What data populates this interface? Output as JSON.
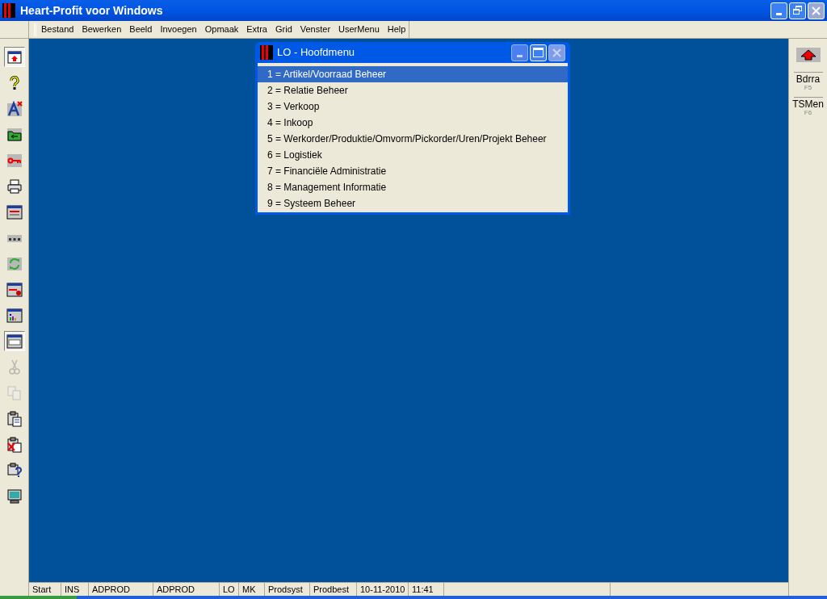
{
  "window": {
    "title": "Heart-Profit voor Windows"
  },
  "menu": [
    "Bestand",
    "Bewerken",
    "Beeld",
    "Invoegen",
    "Opmaak",
    "Extra",
    "Grid",
    "Venster",
    "UserMenu",
    "Help"
  ],
  "left_toolbar": [
    {
      "kind": "screen",
      "pressed": true,
      "disabled": false
    },
    {
      "kind": "help",
      "pressed": false,
      "disabled": false
    },
    {
      "kind": "font",
      "pressed": false,
      "disabled": false
    },
    {
      "kind": "folder",
      "pressed": false,
      "disabled": false
    },
    {
      "kind": "key",
      "pressed": false,
      "disabled": false
    },
    {
      "kind": "printer",
      "pressed": false,
      "disabled": false
    },
    {
      "kind": "form",
      "pressed": false,
      "disabled": false
    },
    {
      "kind": "dots",
      "pressed": false,
      "disabled": false
    },
    {
      "kind": "refresh",
      "pressed": false,
      "disabled": false
    },
    {
      "kind": "formlock",
      "pressed": false,
      "disabled": false
    },
    {
      "kind": "chart",
      "pressed": false,
      "disabled": false
    },
    {
      "kind": "window",
      "pressed": true,
      "disabled": false
    },
    {
      "kind": "scissors",
      "pressed": false,
      "disabled": true
    },
    {
      "kind": "copy",
      "pressed": false,
      "disabled": true
    },
    {
      "kind": "paste",
      "pressed": false,
      "disabled": false
    },
    {
      "kind": "pastedel",
      "pressed": false,
      "disabled": false
    },
    {
      "kind": "pastehelp",
      "pressed": false,
      "disabled": false
    },
    {
      "kind": "monitor",
      "pressed": false,
      "disabled": false
    }
  ],
  "right_toolbar": [
    {
      "kind": "up"
    },
    {
      "kind": "text",
      "label": "Bdrra",
      "key": "F5"
    },
    {
      "kind": "text",
      "label": "TSMen",
      "key": "F6"
    }
  ],
  "dialog": {
    "title": "LO - Hoofdmenu",
    "items": [
      {
        "label": "1 = Artikel/Voorraad Beheer",
        "selected": true
      },
      {
        "label": "2 = Relatie Beheer",
        "selected": false
      },
      {
        "label": "3 = Verkoop",
        "selected": false
      },
      {
        "label": "4 = Inkoop",
        "selected": false
      },
      {
        "label": "5 = Werkorder/Produktie/Omvorm/Pickorder/Uren/Projekt Beheer",
        "selected": false
      },
      {
        "label": "6 = Logistiek",
        "selected": false
      },
      {
        "label": "7 = Financiële Administratie",
        "selected": false
      },
      {
        "label": "8 = Management Informatie",
        "selected": false
      },
      {
        "label": "9 = Systeem Beheer",
        "selected": false
      }
    ]
  },
  "status_bar": [
    "Start",
    "INS",
    "ADPROD",
    "ADPROD",
    "LO",
    "MK",
    "Prodsyst",
    "Prodbest",
    "10-11-2010",
    "11:41"
  ]
}
